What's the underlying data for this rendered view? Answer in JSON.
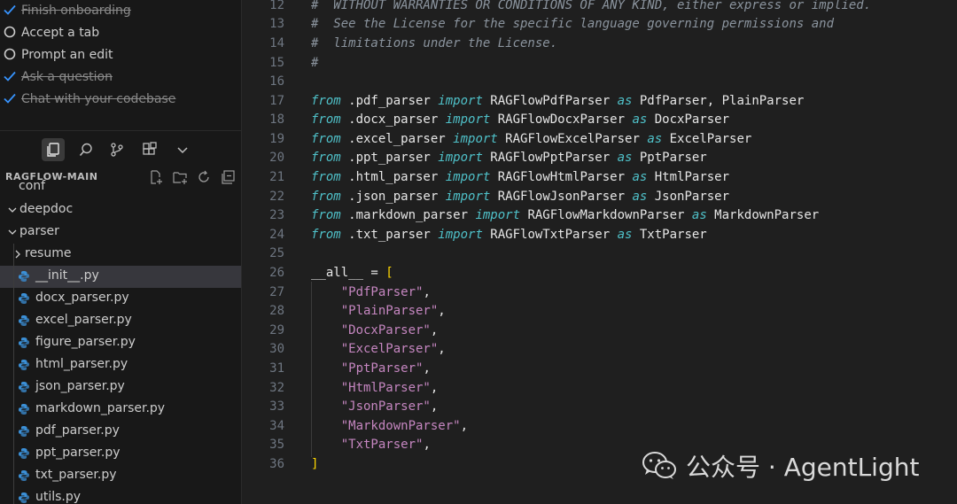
{
  "onboarding": {
    "items": [
      {
        "label": "Finish onboarding",
        "done": true
      },
      {
        "label": "Accept a tab",
        "done": false
      },
      {
        "label": "Prompt an edit",
        "done": false
      },
      {
        "label": "Ask a question",
        "done": true
      },
      {
        "label": "Chat with your codebase",
        "done": true
      }
    ]
  },
  "activity_icons": [
    "files-icon",
    "search-icon",
    "source-control-icon",
    "extensions-icon",
    "chevron-down-icon"
  ],
  "explorer": {
    "title": "RAGFLOW-MAIN",
    "actions": [
      "new-file-icon",
      "new-folder-icon",
      "refresh-icon",
      "collapse-all-icon"
    ],
    "tree": [
      {
        "name": "conf",
        "type": "folder",
        "depth": 1,
        "expanded": false
      },
      {
        "name": "deepdoc",
        "type": "folder",
        "depth": 0,
        "expanded": true
      },
      {
        "name": "parser",
        "type": "folder",
        "depth": 1,
        "expanded": true
      },
      {
        "name": "resume",
        "type": "folder",
        "depth": 2,
        "expanded": false
      },
      {
        "name": "__init__.py",
        "type": "python",
        "depth": 2,
        "selected": true
      },
      {
        "name": "docx_parser.py",
        "type": "python",
        "depth": 2
      },
      {
        "name": "excel_parser.py",
        "type": "python",
        "depth": 2
      },
      {
        "name": "figure_parser.py",
        "type": "python",
        "depth": 2
      },
      {
        "name": "html_parser.py",
        "type": "python",
        "depth": 2
      },
      {
        "name": "json_parser.py",
        "type": "python",
        "depth": 2
      },
      {
        "name": "markdown_parser.py",
        "type": "python",
        "depth": 2
      },
      {
        "name": "pdf_parser.py",
        "type": "python",
        "depth": 2
      },
      {
        "name": "ppt_parser.py",
        "type": "python",
        "depth": 2
      },
      {
        "name": "txt_parser.py",
        "type": "python",
        "depth": 2
      },
      {
        "name": "utils.py",
        "type": "python",
        "depth": 2
      }
    ]
  },
  "editor": {
    "lines": [
      {
        "num": "12",
        "tokens": [
          [
            "cm",
            "#  WITHOUT WARRANTIES OR CONDITIONS OF ANY KIND, either express or implied."
          ]
        ]
      },
      {
        "num": "13",
        "tokens": [
          [
            "cm",
            "#  See the License for the specific language governing permissions and"
          ]
        ]
      },
      {
        "num": "14",
        "tokens": [
          [
            "cm",
            "#  limitations under the License."
          ]
        ]
      },
      {
        "num": "15",
        "tokens": [
          [
            "cm",
            "#"
          ]
        ]
      },
      {
        "num": "16",
        "tokens": []
      },
      {
        "num": "17",
        "tokens": [
          [
            "kw",
            "from"
          ],
          [
            "ident",
            " .pdf_parser "
          ],
          [
            "kw",
            "import"
          ],
          [
            "ident",
            " RAGFlowPdfParser "
          ],
          [
            "kw",
            "as"
          ],
          [
            "ident",
            " PdfParser, PlainParser"
          ]
        ]
      },
      {
        "num": "18",
        "tokens": [
          [
            "kw",
            "from"
          ],
          [
            "ident",
            " .docx_parser "
          ],
          [
            "kw",
            "import"
          ],
          [
            "ident",
            " RAGFlowDocxParser "
          ],
          [
            "kw",
            "as"
          ],
          [
            "ident",
            " DocxParser"
          ]
        ]
      },
      {
        "num": "19",
        "tokens": [
          [
            "kw",
            "from"
          ],
          [
            "ident",
            " .excel_parser "
          ],
          [
            "kw",
            "import"
          ],
          [
            "ident",
            " RAGFlowExcelParser "
          ],
          [
            "kw",
            "as"
          ],
          [
            "ident",
            " ExcelParser"
          ]
        ]
      },
      {
        "num": "20",
        "tokens": [
          [
            "kw",
            "from"
          ],
          [
            "ident",
            " .ppt_parser "
          ],
          [
            "kw",
            "import"
          ],
          [
            "ident",
            " RAGFlowPptParser "
          ],
          [
            "kw",
            "as"
          ],
          [
            "ident",
            " PptParser"
          ]
        ]
      },
      {
        "num": "21",
        "tokens": [
          [
            "kw",
            "from"
          ],
          [
            "ident",
            " .html_parser "
          ],
          [
            "kw",
            "import"
          ],
          [
            "ident",
            " RAGFlowHtmlParser "
          ],
          [
            "kw",
            "as"
          ],
          [
            "ident",
            " HtmlParser"
          ]
        ]
      },
      {
        "num": "22",
        "tokens": [
          [
            "kw",
            "from"
          ],
          [
            "ident",
            " .json_parser "
          ],
          [
            "kw",
            "import"
          ],
          [
            "ident",
            " RAGFlowJsonParser "
          ],
          [
            "kw",
            "as"
          ],
          [
            "ident",
            " JsonParser"
          ]
        ]
      },
      {
        "num": "23",
        "tokens": [
          [
            "kw",
            "from"
          ],
          [
            "ident",
            " .markdown_parser "
          ],
          [
            "kw",
            "import"
          ],
          [
            "ident",
            " RAGFlowMarkdownParser "
          ],
          [
            "kw",
            "as"
          ],
          [
            "ident",
            " MarkdownParser"
          ]
        ]
      },
      {
        "num": "24",
        "tokens": [
          [
            "kw",
            "from"
          ],
          [
            "ident",
            " .txt_parser "
          ],
          [
            "kw",
            "import"
          ],
          [
            "ident",
            " RAGFlowTxtParser "
          ],
          [
            "kw",
            "as"
          ],
          [
            "ident",
            " TxtParser"
          ]
        ]
      },
      {
        "num": "25",
        "tokens": []
      },
      {
        "num": "26",
        "tokens": [
          [
            "ident",
            "__all__ = "
          ],
          [
            "br",
            "["
          ]
        ]
      },
      {
        "num": "27",
        "tokens": [
          [
            "ident",
            "    "
          ],
          [
            "str",
            "\"PdfParser\""
          ],
          [
            "ident",
            ","
          ]
        ]
      },
      {
        "num": "28",
        "tokens": [
          [
            "ident",
            "    "
          ],
          [
            "str",
            "\"PlainParser\""
          ],
          [
            "ident",
            ","
          ]
        ]
      },
      {
        "num": "29",
        "tokens": [
          [
            "ident",
            "    "
          ],
          [
            "str",
            "\"DocxParser\""
          ],
          [
            "ident",
            ","
          ]
        ]
      },
      {
        "num": "30",
        "tokens": [
          [
            "ident",
            "    "
          ],
          [
            "str",
            "\"ExcelParser\""
          ],
          [
            "ident",
            ","
          ]
        ]
      },
      {
        "num": "31",
        "tokens": [
          [
            "ident",
            "    "
          ],
          [
            "str",
            "\"PptParser\""
          ],
          [
            "ident",
            ","
          ]
        ]
      },
      {
        "num": "32",
        "tokens": [
          [
            "ident",
            "    "
          ],
          [
            "str",
            "\"HtmlParser\""
          ],
          [
            "ident",
            ","
          ]
        ]
      },
      {
        "num": "33",
        "tokens": [
          [
            "ident",
            "    "
          ],
          [
            "str",
            "\"JsonParser\""
          ],
          [
            "ident",
            ","
          ]
        ]
      },
      {
        "num": "34",
        "tokens": [
          [
            "ident",
            "    "
          ],
          [
            "str",
            "\"MarkdownParser\""
          ],
          [
            "ident",
            ","
          ]
        ]
      },
      {
        "num": "35",
        "tokens": [
          [
            "ident",
            "    "
          ],
          [
            "str",
            "\"TxtParser\""
          ],
          [
            "ident",
            ","
          ]
        ]
      },
      {
        "num": "36",
        "tokens": [
          [
            "br",
            "]"
          ]
        ]
      }
    ]
  },
  "watermark": {
    "text": "公众号 · AgentLight",
    "logo_icon": "wechat-icon"
  },
  "colors": {
    "background": "#1f1f1f",
    "sidebar": "#181818",
    "keyword": "#4fc1c9",
    "string": "#c586c0",
    "comment": "#8b949e",
    "bracket": "#ffd700",
    "python_icon": "#3b8fd6"
  }
}
